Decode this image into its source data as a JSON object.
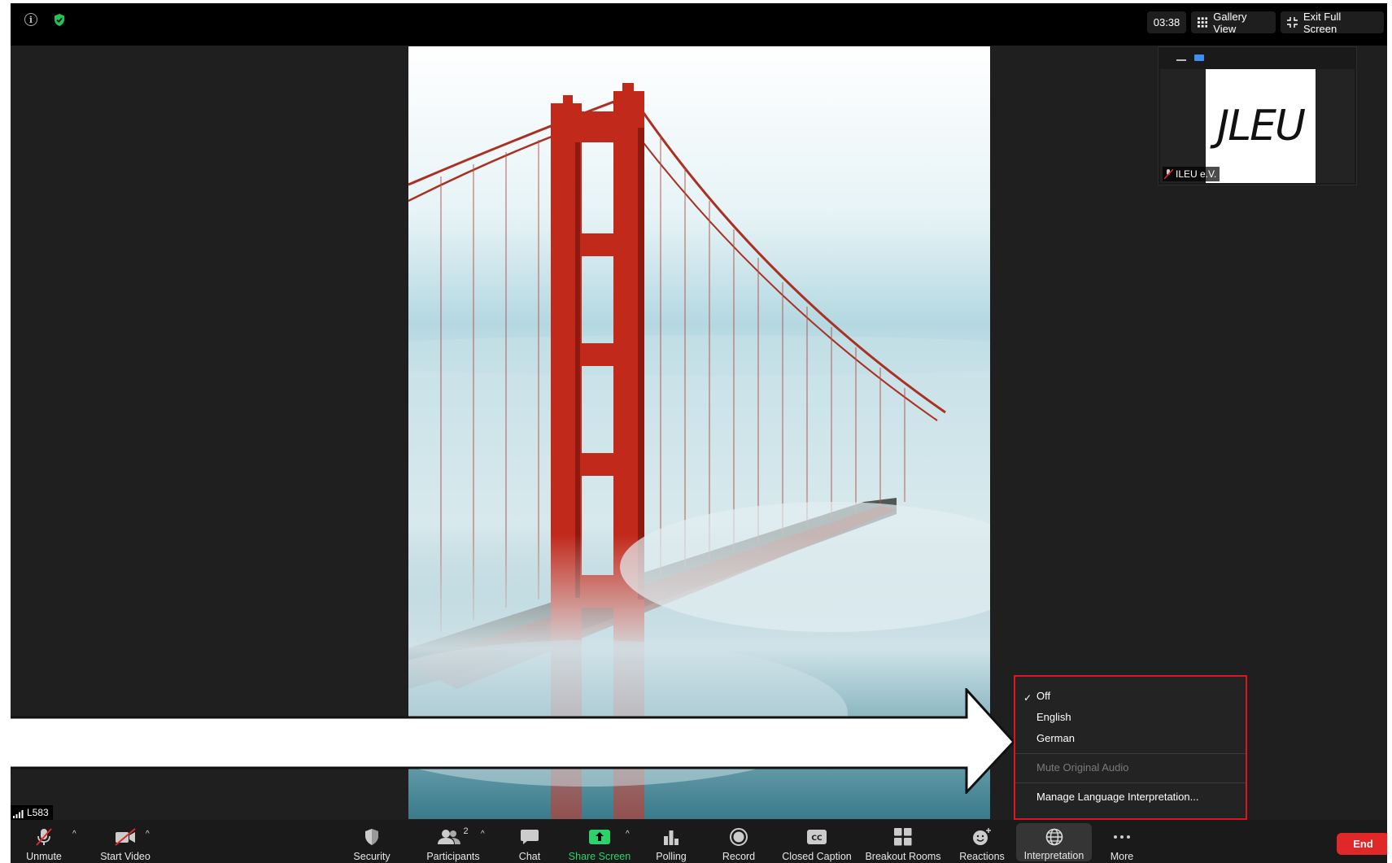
{
  "topbar": {
    "timer": "03:38",
    "gallery_view_label": "Gallery View",
    "exit_fullscreen_label": "Exit Full Screen"
  },
  "thumbnail": {
    "participant_name": "ILEU e.V.",
    "logo_text": "JLEU"
  },
  "signal": {
    "label": "L583"
  },
  "interpretation_menu": {
    "selected": "Off",
    "items": [
      {
        "label": "Off",
        "checked": true
      },
      {
        "label": "English",
        "checked": false
      },
      {
        "label": "German",
        "checked": false
      }
    ],
    "mute_original_label": "Mute Original Audio",
    "manage_label": "Manage Language Interpretation..."
  },
  "toolbar": {
    "unmute_label": "Unmute",
    "start_video_label": "Start Video",
    "security_label": "Security",
    "participants_label": "Participants",
    "participants_count": "2",
    "chat_label": "Chat",
    "share_screen_label": "Share Screen",
    "polling_label": "Polling",
    "record_label": "Record",
    "closed_caption_label": "Closed Caption",
    "breakout_rooms_label": "Breakout Rooms",
    "reactions_label": "Reactions",
    "interpretation_label": "Interpretation",
    "more_label": "More",
    "end_label": "End"
  },
  "colors": {
    "share_green": "#2cd36b",
    "end_red": "#e02828",
    "highlight_red": "#e0141e",
    "thumb_accent": "#3b8ff5"
  },
  "icons": [
    "info-icon",
    "shield-check-icon",
    "gallery-grid-icon",
    "exit-fullscreen-icon",
    "muted-mic-icon",
    "muted-video-icon",
    "security-shield-icon",
    "participants-icon",
    "chat-bubble-icon",
    "share-screen-icon",
    "polling-bars-icon",
    "record-icon",
    "closed-caption-icon",
    "breakout-rooms-icon",
    "reactions-icon",
    "globe-icon",
    "more-dots-icon"
  ]
}
